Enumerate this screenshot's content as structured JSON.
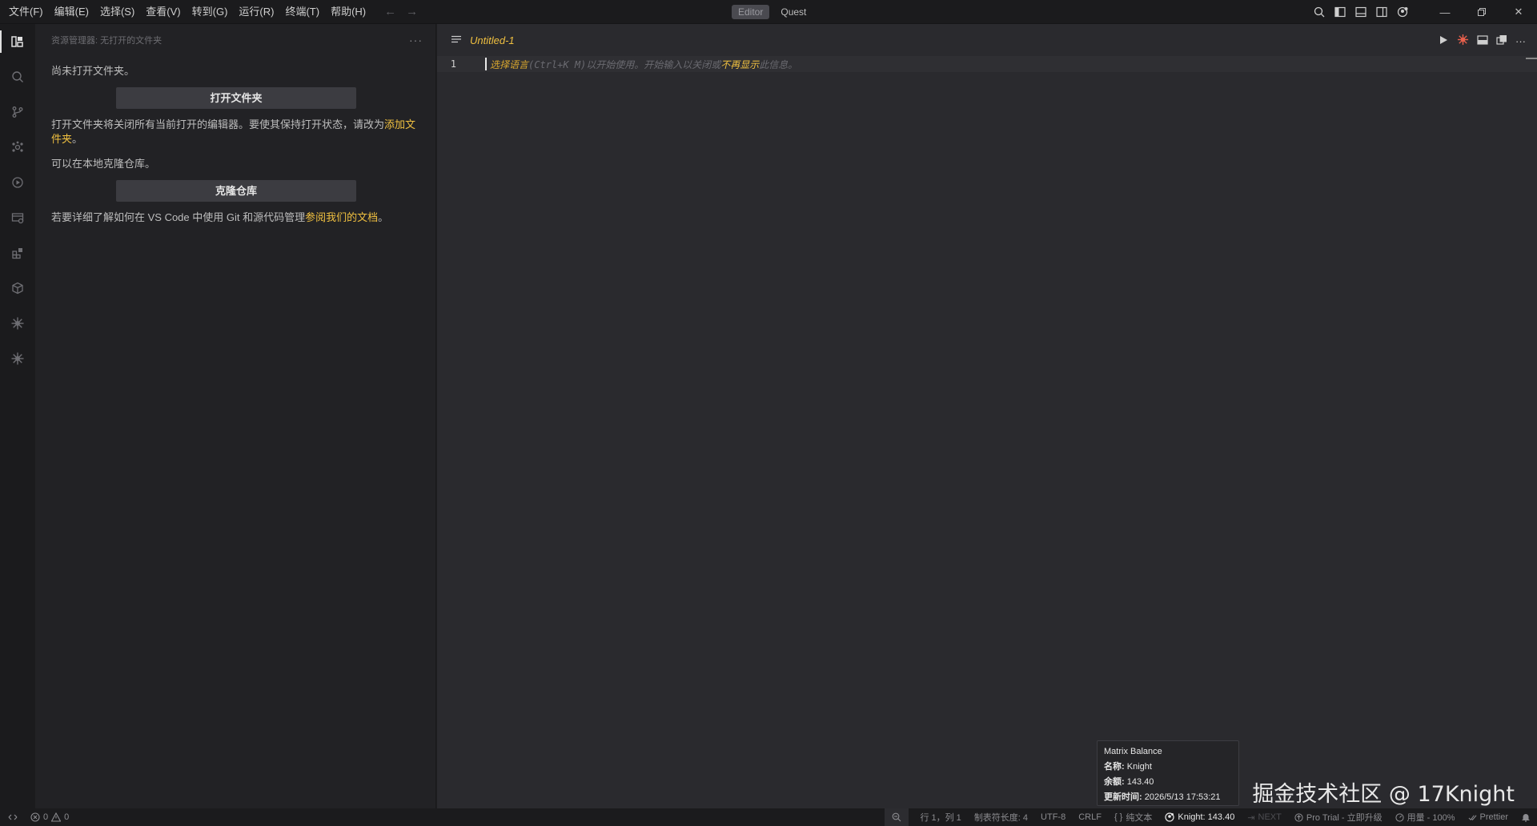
{
  "menu": [
    "文件(F)",
    "编辑(E)",
    "选择(S)",
    "查看(V)",
    "转到(G)",
    "运行(R)",
    "终端(T)",
    "帮助(H)"
  ],
  "mode": {
    "editor": "Editor",
    "quest": "Quest"
  },
  "sidebar": {
    "title": "资源管理器: 无打开的文件夹",
    "more": "···",
    "no_folder": "尚未打开文件夹。",
    "open_folder_button": "打开文件夹",
    "close_notice_prefix": "打开文件夹将关闭所有当前打开的编辑器。要使其保持打开状态，请改为",
    "close_notice_link": "添加文件夹",
    "close_notice_suffix": "。",
    "clone_text": "可以在本地克隆仓库。",
    "clone_button": "克隆仓库",
    "learn_prefix": "若要详细了解如何在 VS Code 中使用 Git 和源代码管理",
    "learn_link": "参阅我们的文档",
    "learn_suffix": "。"
  },
  "editor": {
    "tab_title": "Untitled-1",
    "line_number": "1",
    "hint_part1": "选择语言",
    "hint_part2": "(Ctrl+K M)以开始使用。开始输入以关闭或",
    "hint_part3": "不再显示",
    "hint_part4": "此信息。"
  },
  "tooltip": {
    "title": "Matrix Balance",
    "name_label": "名称:",
    "name_value": "Knight",
    "balance_label": "余额:",
    "balance_value": "143.40",
    "updated_label": "更新时间:",
    "updated_value": "2026/5/13 17:53:21"
  },
  "watermark": "掘金技术社区 @ 17Knight",
  "status": {
    "errors": "0",
    "warnings": "0",
    "position": "行 1，列 1",
    "tab_size": "制表符长度: 4",
    "encoding": "UTF-8",
    "eol": "CRLF",
    "language": "纯文本",
    "knight": "Knight: 143.40",
    "next": "NEXT",
    "pro_trial": "Pro Trial - 立即升级",
    "usage": "用量 - 100%",
    "prettier": "Prettier"
  },
  "colors": {
    "accent": "#f0c040",
    "background": "#1e1e21",
    "editor_bg": "#2a2a2e",
    "sidebar_bg": "#222225",
    "run_debug": "#e8604c"
  }
}
